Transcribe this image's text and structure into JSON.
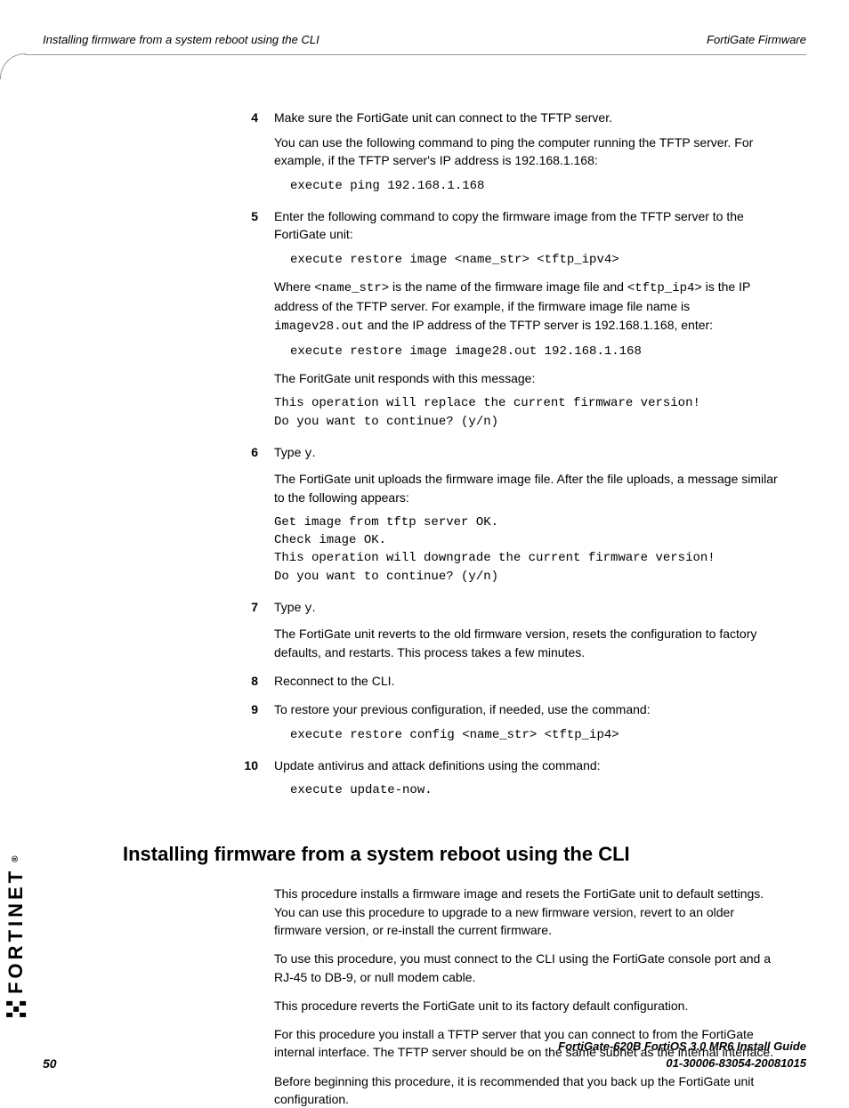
{
  "header": {
    "left": "Installing firmware from a system reboot using the CLI",
    "right": "FortiGate Firmware"
  },
  "steps": {
    "s4": {
      "num": "4",
      "p1": "Make sure the FortiGate unit can connect to the TFTP server.",
      "p2": "You can use the following command to ping the computer running the TFTP server. For example, if the TFTP server's IP address is 192.168.1.168:",
      "code1": "execute ping 192.168.1.168"
    },
    "s5": {
      "num": "5",
      "p1": "Enter the following command to copy the firmware image from the TFTP server to the FortiGate unit:",
      "code1": "execute restore image <name_str> <tftp_ipv4>",
      "p2a": "Where ",
      "p2b": "<name_str>",
      "p2c": " is the name of the firmware image file and ",
      "p2d": "<tftp_ip4>",
      "p2e": " is the IP address of the TFTP server. For example, if the firmware image file name is ",
      "p2f": "imagev28.out",
      "p2g": " and the IP address of the TFTP server is 192.168.1.168, enter:",
      "code2": "execute restore image image28.out 192.168.1.168",
      "p3": "The ForitGate unit responds with this message:",
      "code3": "This operation will replace the current firmware version!\nDo you want to continue? (y/n)"
    },
    "s6": {
      "num": "6",
      "p1a": "Type ",
      "p1b": "y",
      "p1c": ".",
      "p2": "The FortiGate unit uploads the firmware image file. After the file uploads, a message similar to the following appears:",
      "code1": "Get image from tftp server OK.\nCheck image OK.\nThis operation will downgrade the current firmware version!\nDo you want to continue? (y/n)"
    },
    "s7": {
      "num": "7",
      "p1a": "Type ",
      "p1b": "y",
      "p1c": ".",
      "p2": "The FortiGate unit reverts to the old firmware version, resets the configuration to factory defaults, and restarts. This process takes a few minutes."
    },
    "s8": {
      "num": "8",
      "p1": "Reconnect to the CLI."
    },
    "s9": {
      "num": "9",
      "p1": "To restore your previous configuration, if needed, use the command:",
      "code1": "execute restore config <name_str> <tftp_ip4>"
    },
    "s10": {
      "num": "10",
      "p1": "Update antivirus and attack definitions using the command:",
      "code1": "execute update-now."
    }
  },
  "section": {
    "title": "Installing firmware from a system reboot using the CLI",
    "p1": "This procedure installs a firmware image and resets the FortiGate unit to default settings. You can use this procedure to upgrade to a new firmware version, revert to an older firmware version, or re-install the current firmware.",
    "p2": "To use this procedure, you must connect to the CLI using the FortiGate console port and a RJ-45 to DB-9, or null modem cable.",
    "p3": "This procedure reverts the FortiGate unit to its factory default configuration.",
    "p4": "For this procedure you install a TFTP server that you can connect to from the FortiGate internal interface. The TFTP server should be on the same subnet as the internal interface.",
    "p5": "Before beginning this procedure, it is recommended that you back up the FortiGate unit configuration."
  },
  "footer": {
    "page": "50",
    "guide": "FortiGate-620B FortiOS 3.0 MR6 Install Guide",
    "docid": "01-30006-83054-20081015"
  },
  "logo": {
    "text": "FORTINET"
  }
}
